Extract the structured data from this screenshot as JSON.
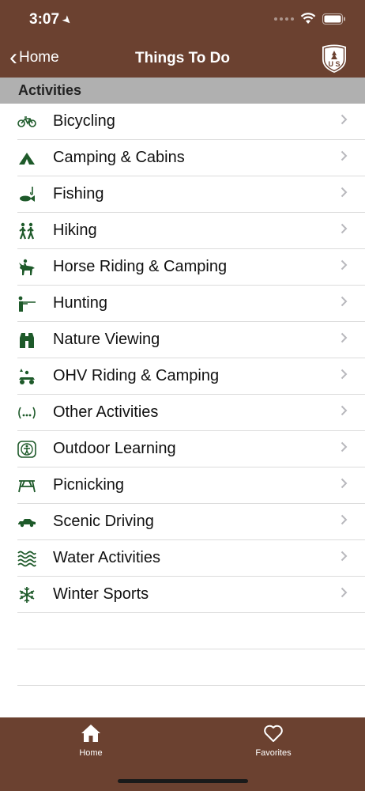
{
  "status_bar": {
    "time": "3:07"
  },
  "nav": {
    "back_label": "Home",
    "title": "Things To Do",
    "logo_text": "U S"
  },
  "section": {
    "header": "Activities"
  },
  "activities": [
    {
      "label": "Bicycling",
      "icon": "bicycle-icon"
    },
    {
      "label": "Camping & Cabins",
      "icon": "tent-icon"
    },
    {
      "label": "Fishing",
      "icon": "fish-icon"
    },
    {
      "label": "Hiking",
      "icon": "hikers-icon"
    },
    {
      "label": "Horse Riding & Camping",
      "icon": "horse-rider-icon"
    },
    {
      "label": "Hunting",
      "icon": "hunter-icon"
    },
    {
      "label": "Nature Viewing",
      "icon": "binoculars-icon"
    },
    {
      "label": "OHV Riding & Camping",
      "icon": "atv-icon"
    },
    {
      "label": "Other Activities",
      "icon": "ellipsis-icon"
    },
    {
      "label": "Outdoor Learning",
      "icon": "learning-icon"
    },
    {
      "label": "Picnicking",
      "icon": "picnic-table-icon"
    },
    {
      "label": "Scenic Driving",
      "icon": "car-icon"
    },
    {
      "label": "Water Activities",
      "icon": "waves-icon"
    },
    {
      "label": "Winter Sports",
      "icon": "snowflake-icon"
    }
  ],
  "tabs": [
    {
      "label": "Home",
      "icon": "home-icon"
    },
    {
      "label": "Favorites",
      "icon": "heart-icon"
    }
  ],
  "colors": {
    "brand_brown": "#6b4130",
    "icon_green": "#1e5a2a",
    "section_gray": "#b0b0b0"
  }
}
